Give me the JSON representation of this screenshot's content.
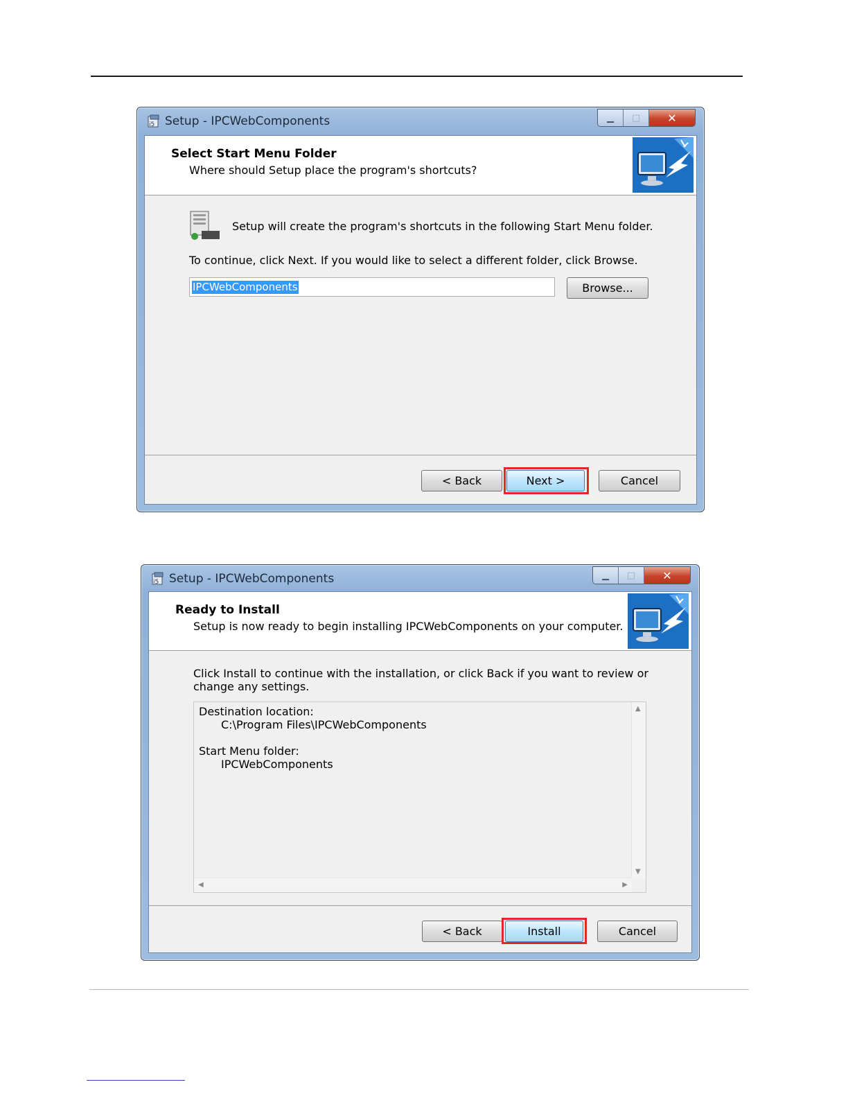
{
  "dialog1": {
    "window_title": "Setup - IPCWebComponents",
    "header_title": "Select Start Menu Folder",
    "header_subtitle": "Where should Setup place the program's shortcuts?",
    "info_text": "Setup will create the program's shortcuts in the following Start Menu folder.",
    "instruction": "To continue, click Next. If you would like to select a different folder, click Browse.",
    "folder_value": "IPCWebComponents",
    "browse_label": "Browse...",
    "back_label": "< Back",
    "next_label": "Next >",
    "cancel_label": "Cancel"
  },
  "dialog2": {
    "window_title": "Setup - IPCWebComponents",
    "header_title": "Ready to Install",
    "header_subtitle": "Setup is now ready to begin installing IPCWebComponents on your computer.",
    "instruction_line1": "Click Install to continue with the installation, or click Back if you want to review or",
    "instruction_line2": "change any settings.",
    "summary": {
      "dest_label": "Destination location:",
      "dest_value": "C:\\Program Files\\IPCWebComponents",
      "start_menu_label": "Start Menu folder:",
      "start_menu_value": "IPCWebComponents"
    },
    "back_label": "< Back",
    "install_label": "Install",
    "cancel_label": "Cancel"
  },
  "highlight_color": "#e3262a",
  "icons": [
    "setup-app-icon",
    "minimize-icon",
    "maximize-icon",
    "close-icon",
    "wizard-monitor-icon",
    "start-menu-folder-icon"
  ]
}
